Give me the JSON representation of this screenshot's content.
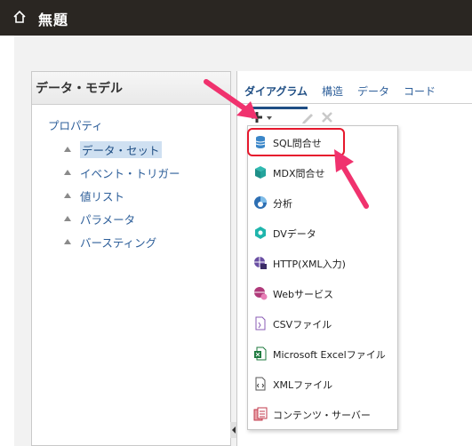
{
  "header": {
    "title": "無題",
    "icon": "home-icon"
  },
  "left_panel": {
    "title": "データ・モデル",
    "properties_link": "プロパティ",
    "items": [
      {
        "label": "データ・セット",
        "selected": true
      },
      {
        "label": "イベント・トリガー",
        "selected": false
      },
      {
        "label": "値リスト",
        "selected": false
      },
      {
        "label": "パラメータ",
        "selected": false
      },
      {
        "label": "バースティング",
        "selected": false
      }
    ]
  },
  "tabs": [
    "ダイアグラム",
    "構造",
    "データ",
    "コード"
  ],
  "active_tab": "ダイアグラム",
  "toolbar": {
    "add": "plus-icon",
    "edit": "pencil-icon",
    "delete": "x-icon"
  },
  "menu": {
    "items": [
      {
        "label": "SQL問合せ",
        "icon": "database-icon",
        "highlighted": true
      },
      {
        "label": "MDX問合せ",
        "icon": "cube-icon"
      },
      {
        "label": "分析",
        "icon": "analysis-icon"
      },
      {
        "label": "DVデータ",
        "icon": "hexagon-icon"
      },
      {
        "label": "HTTP(XML入力)",
        "icon": "globe-icon"
      },
      {
        "label": "Webサービス",
        "icon": "web-service-icon"
      },
      {
        "label": "CSVファイル",
        "icon": "csv-file-icon"
      },
      {
        "label": "Microsoft Excelファイル",
        "icon": "excel-icon"
      },
      {
        "label": "XMLファイル",
        "icon": "xml-file-icon"
      },
      {
        "label": "コンテンツ・サーバー",
        "icon": "content-server-icon"
      }
    ]
  },
  "colors": {
    "header_bg": "#2a2622",
    "link": "#2e5f9a",
    "highlight": "#e6182d",
    "arrow": "#f0326e"
  }
}
